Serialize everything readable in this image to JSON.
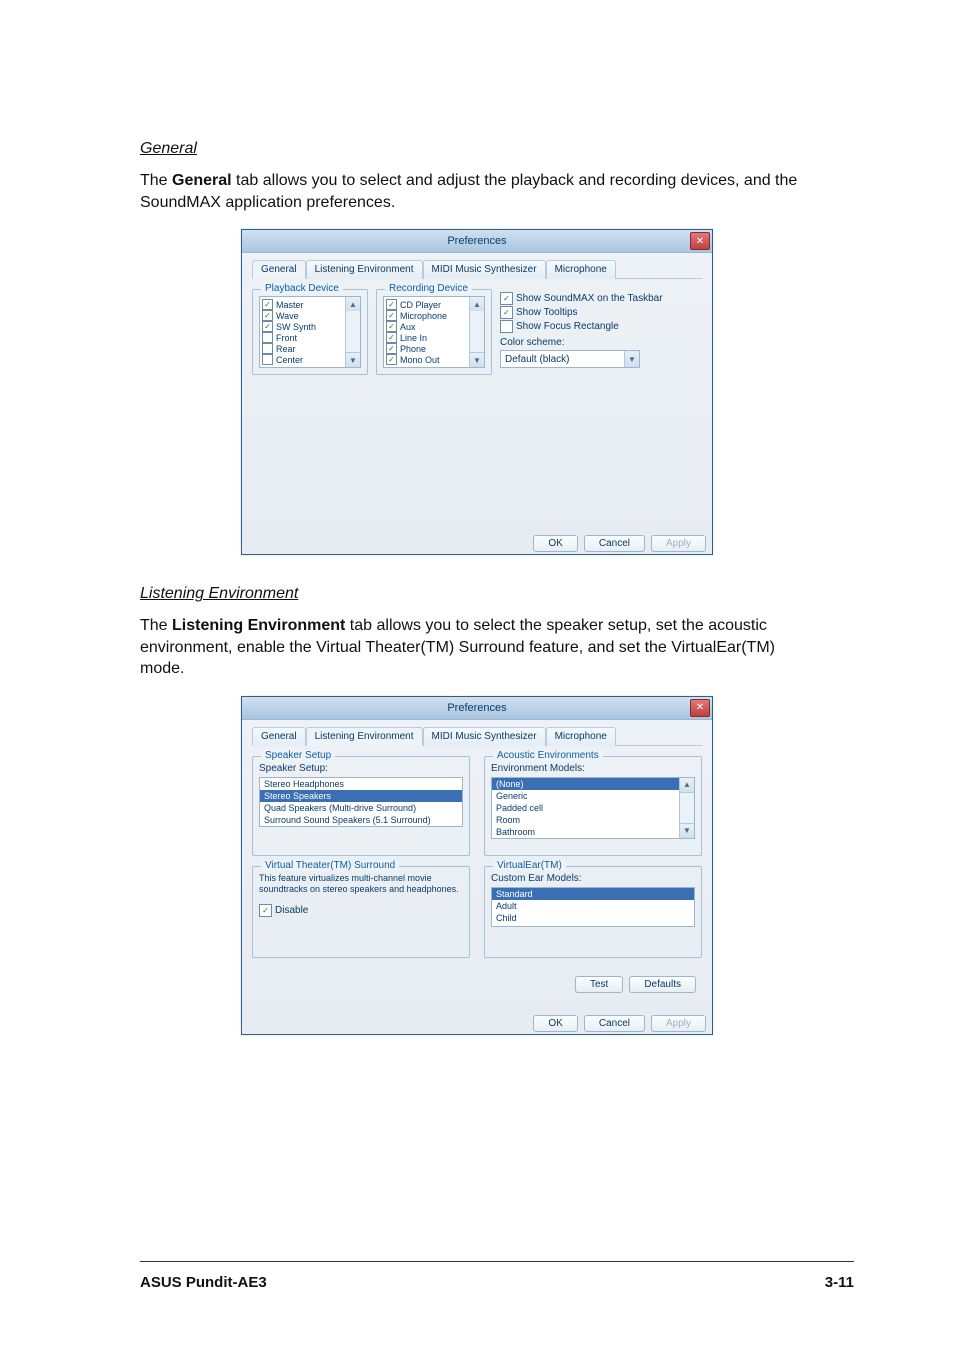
{
  "section1": {
    "heading": "General",
    "para_pre": "The ",
    "para_bold": "General",
    "para_post": " tab allows you to select and adjust the playback and recording devices, and the SoundMAX application preferences."
  },
  "win1": {
    "title": "Preferences",
    "close": "✕",
    "tabs": [
      "General",
      "Listening Environment",
      "MIDI Music Synthesizer",
      "Microphone"
    ],
    "active_tab": 0,
    "playback": {
      "legend": "Playback Device",
      "items": [
        {
          "label": "Master",
          "checked": true
        },
        {
          "label": "Wave",
          "checked": true
        },
        {
          "label": "SW Synth",
          "checked": true
        },
        {
          "label": "Front",
          "checked": false
        },
        {
          "label": "Rear",
          "checked": false
        },
        {
          "label": "Center",
          "checked": false
        }
      ]
    },
    "recording": {
      "legend": "Recording Device",
      "items": [
        {
          "label": "CD Player",
          "checked": true
        },
        {
          "label": "Microphone",
          "checked": true
        },
        {
          "label": "Aux",
          "checked": true
        },
        {
          "label": "Line In",
          "checked": true
        },
        {
          "label": "Phone",
          "checked": true
        },
        {
          "label": "Mono Out",
          "checked": true
        }
      ]
    },
    "options": {
      "show_taskbar": {
        "label": "Show SoundMAX on the Taskbar",
        "checked": true
      },
      "show_tooltips": {
        "label": "Show Tooltips",
        "checked": true
      },
      "show_focus": {
        "label": "Show Focus Rectangle",
        "checked": false
      },
      "color_scheme_label": "Color scheme:",
      "color_scheme_value": "Default (black)"
    },
    "buttons": {
      "ok": "OK",
      "cancel": "Cancel",
      "apply": "Apply"
    }
  },
  "section2": {
    "heading": "Listening Environment",
    "para_pre": "The ",
    "para_bold": "Listening Environment",
    "para_post": " tab allows you to select the speaker setup, set the acoustic environment, enable the Virtual Theater(TM) Surround feature, and set the VirtualEar(TM) mode."
  },
  "win2": {
    "title": "Preferences",
    "close": "✕",
    "tabs": [
      "General",
      "Listening Environment",
      "MIDI Music Synthesizer",
      "Microphone"
    ],
    "active_tab": 1,
    "speaker": {
      "legend": "Speaker Setup",
      "label": "Speaker Setup:",
      "options": [
        "Stereo Headphones",
        "Stereo Speakers",
        "Quad Speakers (Multi-drive Surround)",
        "Surround Sound Speakers (5.1 Surround)"
      ],
      "selected_index": 1
    },
    "acoustic": {
      "legend": "Acoustic Environments",
      "label": "Environment Models:",
      "options": [
        "(None)",
        "Generic",
        "Padded cell",
        "Room",
        "Bathroom"
      ],
      "selected_index": 0
    },
    "vts": {
      "legend": "Virtual Theater(TM) Surround",
      "desc": "This feature virtualizes multi-channel movie soundtracks on stereo speakers and headphones.",
      "disable": {
        "label": "Disable",
        "checked": true
      }
    },
    "vear": {
      "legend": "VirtualEar(TM)",
      "label": "Custom Ear Models:",
      "options": [
        "Standard",
        "Adult",
        "Child"
      ],
      "selected_index": 0
    },
    "midbuttons": {
      "test": "Test",
      "defaults": "Defaults"
    },
    "buttons": {
      "ok": "OK",
      "cancel": "Cancel",
      "apply": "Apply"
    }
  },
  "footer": {
    "left": "ASUS Pundit-AE3",
    "right": "3-11"
  }
}
